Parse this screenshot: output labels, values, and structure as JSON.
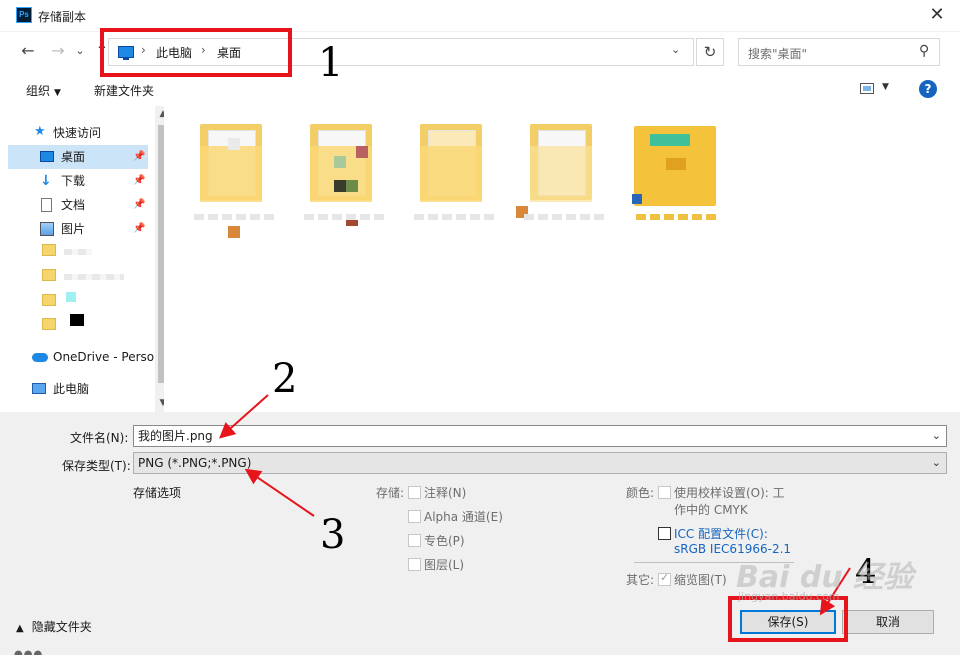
{
  "window": {
    "title": "存储副本",
    "app_icon_text": "Ps",
    "close_glyph": "✕"
  },
  "navbar": {
    "back": "←",
    "forward": "→",
    "recent": "⌄",
    "up": "↑",
    "breadcrumb": [
      "此电脑",
      "桌面"
    ],
    "separator": "›",
    "dropdown": "⌄",
    "refresh": "↻",
    "search_placeholder": "搜索\"桌面\"",
    "search_icon": "⚲"
  },
  "toolbar": {
    "organize": "组织",
    "organize_caret": "▼",
    "new_folder": "新建文件夹",
    "view_caret": "▼",
    "help": "?"
  },
  "nav_pane": {
    "items": [
      {
        "label": "快速访问",
        "icon": "star-icon"
      },
      {
        "label": "桌面",
        "icon": "desktop-icon",
        "pinned": true,
        "selected": true
      },
      {
        "label": "下载",
        "icon": "download-icon",
        "pinned": true
      },
      {
        "label": "文档",
        "icon": "document-icon",
        "pinned": true
      },
      {
        "label": "图片",
        "icon": "picture-icon",
        "pinned": true
      },
      {
        "label": "OneDrive - Perso",
        "icon": "cloud-icon"
      },
      {
        "label": "此电脑",
        "icon": "computer-icon"
      }
    ],
    "pin_glyph": "📌",
    "scroll_up": "▲",
    "scroll_down": "▼"
  },
  "form": {
    "filename_label": "文件名(N):",
    "filename_value": "我的图片.png",
    "type_label": "保存类型(T):",
    "type_value": "PNG (*.PNG;*.PNG)",
    "caret": "⌄"
  },
  "options": {
    "title": "存储选项",
    "save_label": "存储:",
    "save_items": [
      "注释(N)",
      "Alpha 通道(E)",
      "专色(P)",
      "图层(L)"
    ],
    "color_label": "颜色:",
    "proof_line1": "使用校样设置(O):  工",
    "proof_line2": "作中的 CMYK",
    "icc_line1": "ICC 配置文件(C):",
    "icc_line2": "sRGB IEC61966-2.1",
    "other_label": "其它:",
    "thumbnail": "缩览图(T)"
  },
  "footer": {
    "hide_folders": "隐藏文件夹",
    "hide_caret": "▲",
    "save_button": "保存(S)",
    "cancel_button": "取消",
    "dots": "●●●"
  },
  "annotations": {
    "n1": "1",
    "n2": "2",
    "n3": "3",
    "n4": "4",
    "color": "#e8141c"
  },
  "watermark": {
    "text": "Bai du 经验",
    "sub": "jingyan.baidu.com"
  }
}
